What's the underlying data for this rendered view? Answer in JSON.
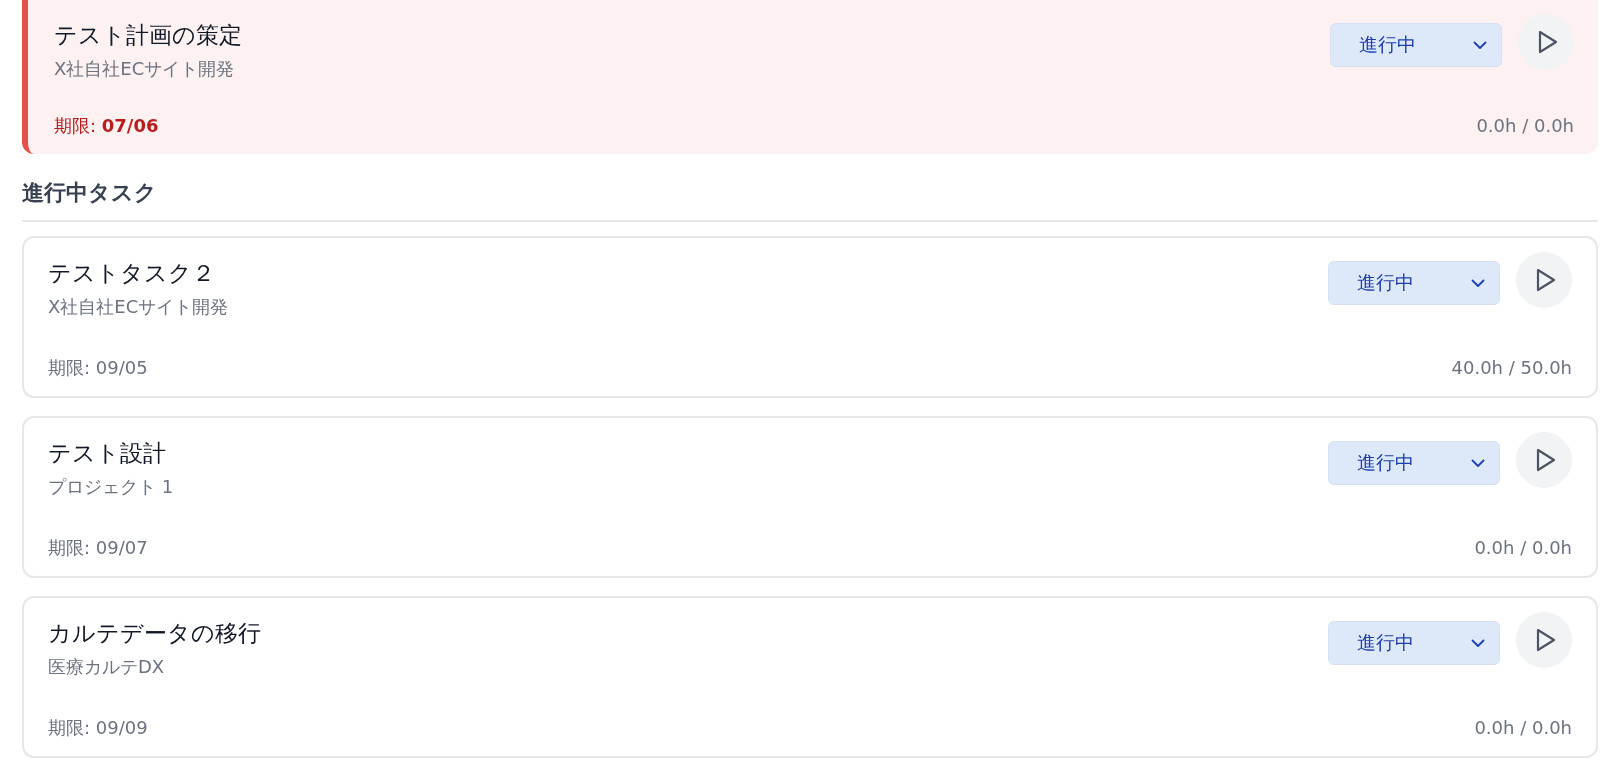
{
  "overdue_tasks": [
    {
      "title": "テスト計画の策定",
      "project": "X社自社ECサイト開発",
      "status": "進行中",
      "due": "期限: **07/06**",
      "hours": "0.0h / 0.0h",
      "overdue": true
    }
  ],
  "section": {
    "title": "進行中タスク"
  },
  "tasks": [
    {
      "title": "テストタスク２",
      "project": "X社自社ECサイト開発",
      "status": "進行中",
      "due": "期限: 09/05",
      "hours": "40.0h / 50.0h",
      "overdue": false
    },
    {
      "title": "テスト設計",
      "project": "プロジェクト 1",
      "status": "進行中",
      "due": "期限: 09/07",
      "hours": "0.0h / 0.0h",
      "overdue": false
    },
    {
      "title": "カルテデータの移行",
      "project": "医療カルテDX",
      "status": "進行中",
      "due": "期限: 09/09",
      "hours": "0.0h / 0.0h",
      "overdue": false
    }
  ]
}
